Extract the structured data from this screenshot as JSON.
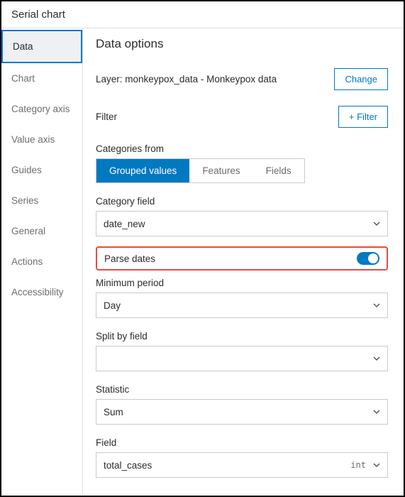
{
  "header": {
    "title": "Serial chart"
  },
  "sidebar": {
    "items": [
      {
        "label": "Data"
      },
      {
        "label": "Chart"
      },
      {
        "label": "Category axis"
      },
      {
        "label": "Value axis"
      },
      {
        "label": "Guides"
      },
      {
        "label": "Series"
      },
      {
        "label": "General"
      },
      {
        "label": "Actions"
      },
      {
        "label": "Accessibility"
      }
    ]
  },
  "main": {
    "title": "Data options",
    "layer_label": "Layer: monkeypox_data - Monkeypox data",
    "change_btn": "Change",
    "filter_label": "Filter",
    "filter_btn": "+ Filter",
    "categories_from_label": "Categories from",
    "categories_from": {
      "grouped": "Grouped values",
      "features": "Features",
      "fields": "Fields"
    },
    "category_field_label": "Category field",
    "category_field_value": "date_new",
    "parse_dates_label": "Parse dates",
    "min_period_label": "Minimum period",
    "min_period_value": "Day",
    "split_by_label": "Split by field",
    "split_by_value": "",
    "statistic_label": "Statistic",
    "statistic_value": "Sum",
    "field_label": "Field",
    "field_value": "total_cases",
    "field_type": "int"
  }
}
